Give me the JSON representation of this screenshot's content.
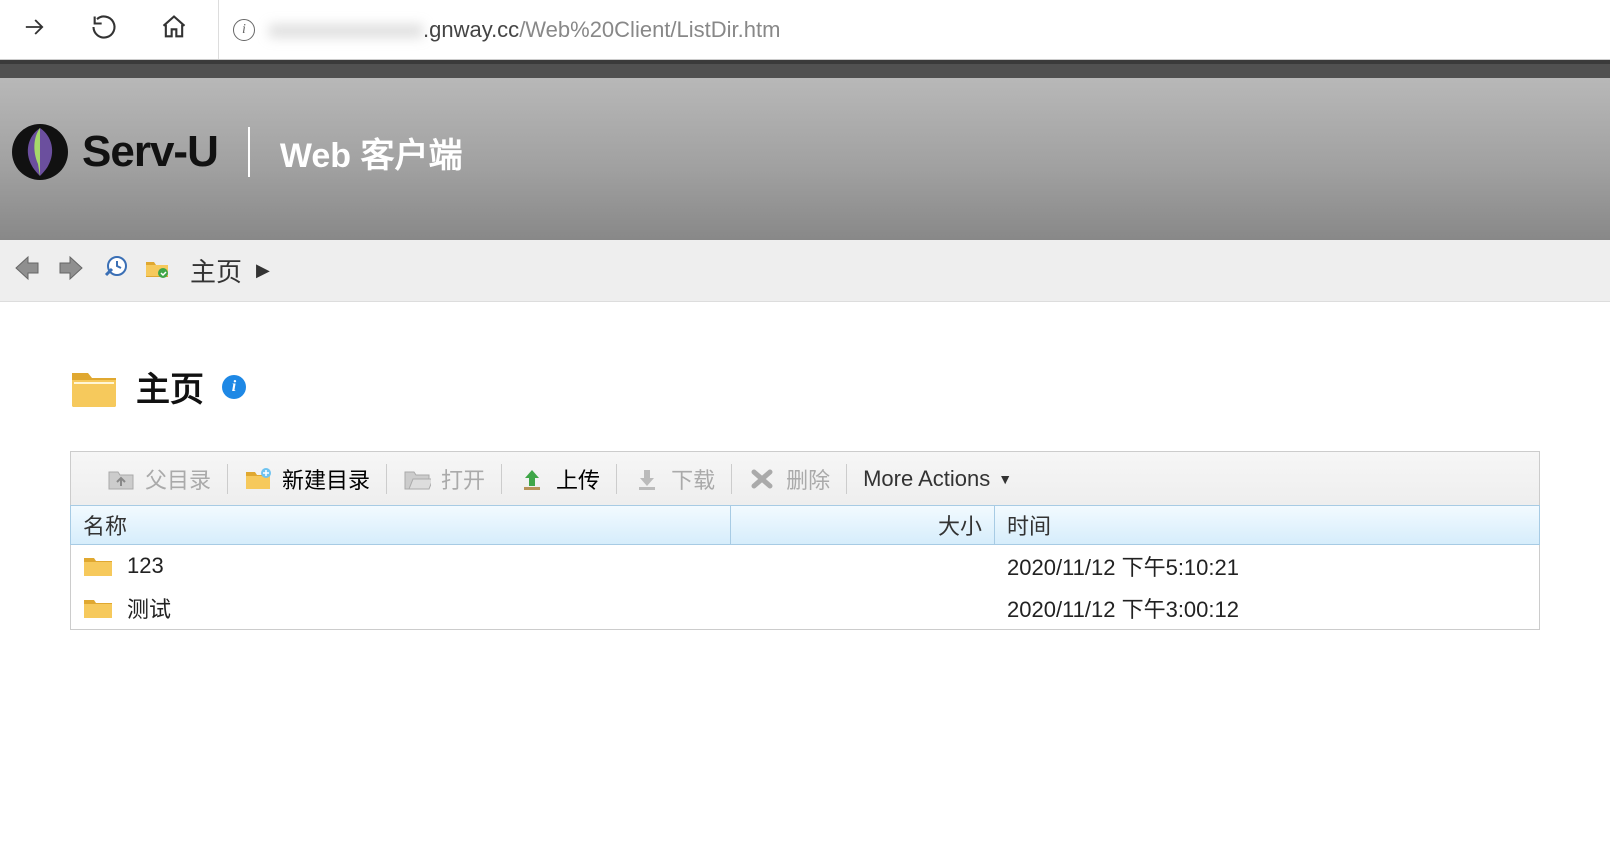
{
  "browser": {
    "url_host": ".gnway.cc",
    "url_path": "/Web%20Client/ListDir.htm"
  },
  "header": {
    "brand": "Serv-U",
    "subtitle": "Web 客户端"
  },
  "nav": {
    "breadcrumb": "主页"
  },
  "page": {
    "title": "主页"
  },
  "actions": {
    "parent_dir": "父目录",
    "new_dir": "新建目录",
    "open": "打开",
    "upload": "上传",
    "download": "下载",
    "delete": "删除",
    "more": "More Actions"
  },
  "table": {
    "headers": {
      "name": "名称",
      "size": "大小",
      "time": "时间"
    },
    "rows": [
      {
        "name": "123",
        "size": "",
        "time": "2020/11/12 下午5:10:21"
      },
      {
        "name": "测试",
        "size": "",
        "time": "2020/11/12 下午3:00:12"
      }
    ]
  }
}
